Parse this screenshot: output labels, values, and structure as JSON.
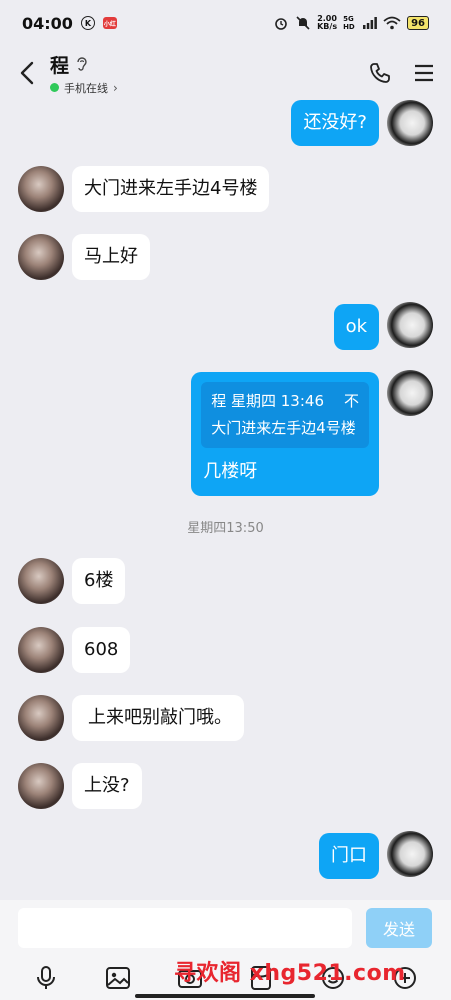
{
  "status_bar": {
    "time": "04:00",
    "k_badge": "K",
    "app_badge": "小红",
    "net_speed_value": "2.00",
    "net_speed_unit": "KB/s",
    "network": "5G HD",
    "battery": "96"
  },
  "header": {
    "contact_name": "程",
    "status_text": "手机在线",
    "chevron": "›"
  },
  "messages": [
    {
      "side": "me",
      "text": "还没好?"
    },
    {
      "side": "peer",
      "text": "大门进来左手边4号楼"
    },
    {
      "side": "peer",
      "text": "马上好"
    },
    {
      "side": "me",
      "text": "ok"
    },
    {
      "side": "me",
      "quote_sender": "程 星期四 13:46",
      "quote_close": "不",
      "quote_text": "大门进来左手边4号楼",
      "text": "几楼呀"
    },
    {
      "side": "peer",
      "text": "6楼"
    },
    {
      "side": "peer",
      "text": "608"
    },
    {
      "side": "peer",
      "text": "上来吧别敲门哦。"
    },
    {
      "side": "peer",
      "text": "上没?"
    },
    {
      "side": "me",
      "text": "门口"
    }
  ],
  "timestamp": "星期四13:50",
  "input": {
    "placeholder": "",
    "value": "",
    "send_label": "发送"
  },
  "toolbar": {
    "icons": [
      "mic-icon",
      "image-icon",
      "camera-icon",
      "red-packet-icon",
      "emoji-icon",
      "plus-icon"
    ]
  },
  "watermark": "寻欢阁 xhg521.com",
  "colors": {
    "accent": "#0ea5f5",
    "send_disabled": "#8fd0f7",
    "online": "#2fc95a",
    "watermark": "#e8262f"
  }
}
